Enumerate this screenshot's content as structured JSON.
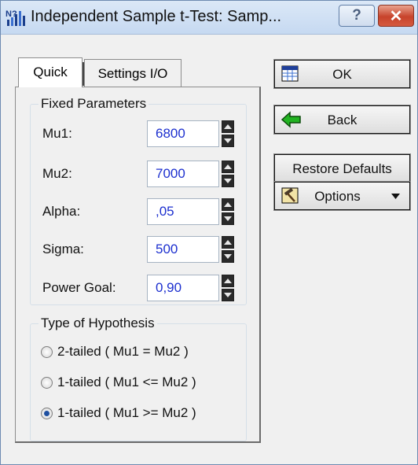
{
  "window": {
    "title": "Independent Sample t-Test: Samp...",
    "help_label": "?",
    "close_label": "✕"
  },
  "tabs": [
    {
      "label": "Quick",
      "active": true
    },
    {
      "label": "Settings I/O",
      "active": false
    }
  ],
  "fixed_parameters": {
    "title": "Fixed Parameters",
    "rows": [
      {
        "label": "Mu1:",
        "value": "6800"
      },
      {
        "label": "Mu2:",
        "value": "7000"
      },
      {
        "label": "Alpha:",
        "value": ",05"
      },
      {
        "label": "Sigma:",
        "value": "500"
      },
      {
        "label": "Power Goal:",
        "value": "0,90"
      }
    ]
  },
  "hypothesis": {
    "title": "Type of Hypothesis",
    "options": [
      {
        "label": "2-tailed ( Mu1 = Mu2 )",
        "selected": false
      },
      {
        "label": "1-tailed ( Mu1 <= Mu2 )",
        "selected": false
      },
      {
        "label": "1-tailed ( Mu1 >= Mu2 )",
        "selected": true
      }
    ]
  },
  "buttons": {
    "ok": "OK",
    "back": "Back",
    "restore": "Restore Defaults",
    "options": "Options"
  },
  "colors": {
    "value_text": "#1c2fcf",
    "back_arrow": "#22b322",
    "close_button": "#c7432b"
  }
}
